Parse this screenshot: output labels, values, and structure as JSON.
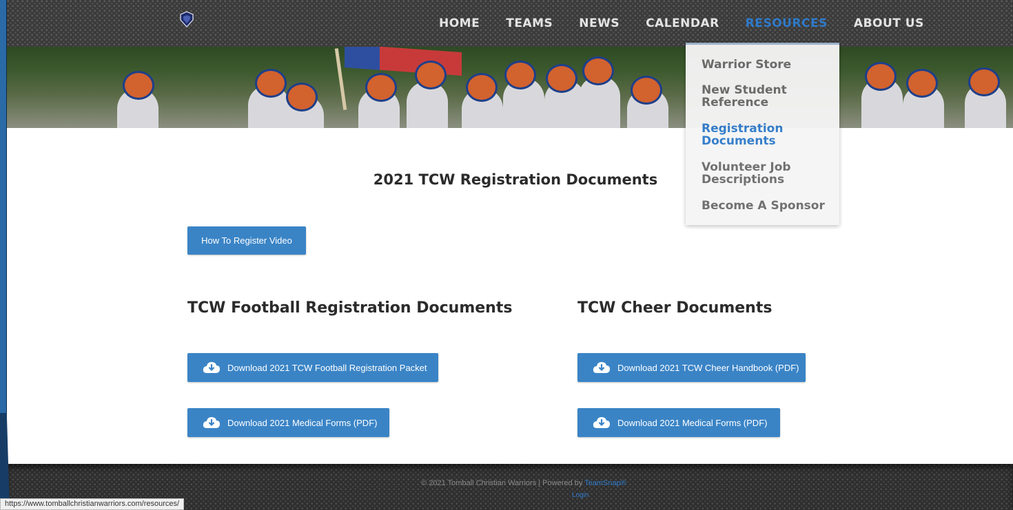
{
  "nav": {
    "items": [
      {
        "label": "HOME"
      },
      {
        "label": "TEAMS"
      },
      {
        "label": "NEWS"
      },
      {
        "label": "CALENDAR"
      },
      {
        "label": "RESOURCES"
      },
      {
        "label": "ABOUT US"
      }
    ],
    "active_index": 4
  },
  "resources_menu": {
    "items": [
      {
        "label": "Warrior Store"
      },
      {
        "label": "New Student Reference"
      },
      {
        "label": "Registration Documents"
      },
      {
        "label": "Volunteer Job Descriptions"
      },
      {
        "label": "Become A Sponsor"
      }
    ],
    "active_index": 2
  },
  "main": {
    "title": "2021 TCW Registration Documents",
    "video_button": "How To Register Video",
    "football": {
      "heading": "TCW Football Registration Documents",
      "buttons": [
        "Download 2021 TCW Football Registration Packet",
        "Download 2021 Medical Forms (PDF)"
      ]
    },
    "cheer": {
      "heading": "TCW Cheer Documents",
      "buttons": [
        "Download 2021 TCW Cheer Handbook (PDF)",
        "Download 2021 Medical Forms (PDF)"
      ]
    }
  },
  "footer": {
    "copyright": "© 2021 Tomball Christian Warriors | Powered by",
    "powered_link": "TeamSnap®",
    "sub_link": "Login"
  },
  "status_bar": {
    "url": "https://www.tomballchristianwarriors.com/resources/"
  },
  "colors": {
    "accent": "#2f7ac9",
    "button": "#3a84c6",
    "header_bg": "#3a3a3a",
    "nav_text": "#e4e4e4"
  },
  "icons": {
    "download": "cloud-download-icon",
    "logo": "shield-logo-icon"
  }
}
